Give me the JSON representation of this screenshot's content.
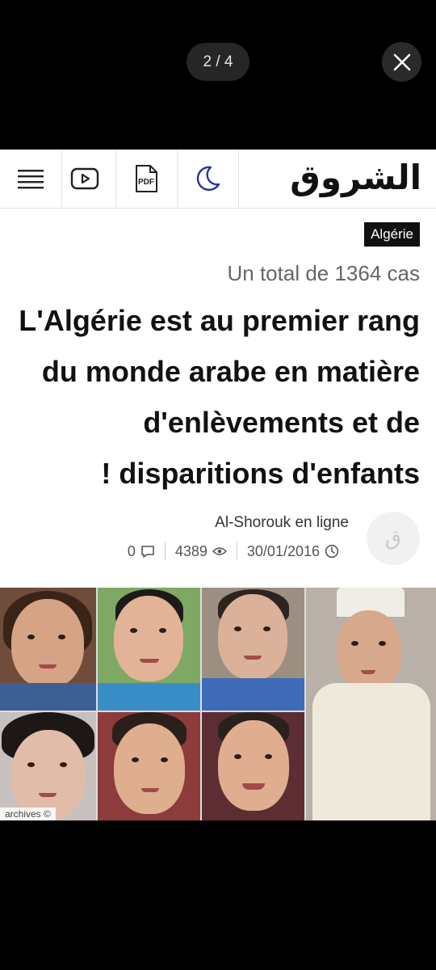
{
  "viewer": {
    "counter": "2 / 4",
    "close_icon": "close-icon"
  },
  "toolbar": {
    "menu_icon": "hamburger-menu-icon",
    "video_icon": "play-video-icon",
    "pdf_label": "PDF",
    "theme_icon": "dark-mode-moon-icon",
    "logo": "الشروق",
    "accent_color": "#23359a"
  },
  "article": {
    "category": "Algérie",
    "subtitle": "Un total de 1364 cas",
    "headline_lines": [
      "L'Algérie est au premier rang",
      "du monde arabe en matière",
      "d'enlèvements et de",
      "! disparitions d'enfants"
    ],
    "author": "Al-Shorouk en ligne",
    "avatar_glyph": "ق",
    "comments": "0",
    "views": "4389",
    "date": "30/01/2016",
    "photo_credit": "archives ©"
  }
}
